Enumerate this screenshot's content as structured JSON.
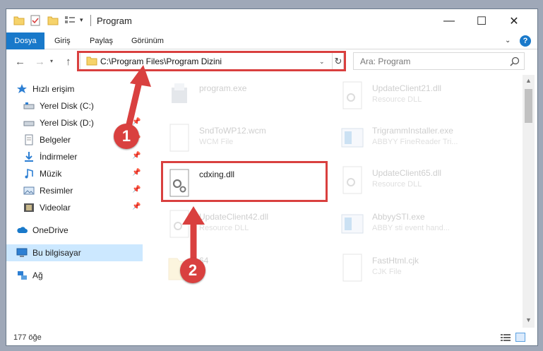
{
  "window": {
    "title": "Program",
    "controls": {
      "minimize": "—",
      "maximize": "☐",
      "close": "✕"
    }
  },
  "ribbon": {
    "tabs": [
      "Dosya",
      "Giriş",
      "Paylaş",
      "Görünüm"
    ],
    "help": "?"
  },
  "nav": {
    "address": "C:\\Program Files\\Program Dizini",
    "search_placeholder": "Ara: Program"
  },
  "sidebar": {
    "items": [
      {
        "label": "Hızlı erişim",
        "icon": "star-icon",
        "pinned": false
      },
      {
        "label": "Yerel Disk (C:)",
        "icon": "drive-icon",
        "pinned": true
      },
      {
        "label": "Yerel Disk (D:)",
        "icon": "drive-icon",
        "pinned": true
      },
      {
        "label": "Belgeler",
        "icon": "document-icon",
        "pinned": true
      },
      {
        "label": "İndirmeler",
        "icon": "download-icon",
        "pinned": true
      },
      {
        "label": "Müzik",
        "icon": "music-icon",
        "pinned": true
      },
      {
        "label": "Resimler",
        "icon": "pictures-icon",
        "pinned": true
      },
      {
        "label": "Videolar",
        "icon": "video-icon",
        "pinned": true
      },
      {
        "label": "OneDrive",
        "icon": "cloud-icon",
        "pinned": false
      },
      {
        "label": "Bu bilgisayar",
        "icon": "computer-icon",
        "pinned": false
      },
      {
        "label": "Ağ",
        "icon": "network-icon",
        "pinned": false
      }
    ]
  },
  "files": [
    {
      "name": "program.exe",
      "type": ""
    },
    {
      "name": "UpdateClient21.dll",
      "type": "Resource DLL"
    },
    {
      "name": "SndToWP12.wcm",
      "type": "WCM File"
    },
    {
      "name": "TrigrammInstaller.exe",
      "type": "ABBYY FineReader Tri..."
    },
    {
      "name": "cdxing.dll",
      "type": ""
    },
    {
      "name": "UpdateClient65.dll",
      "type": "Resource DLL"
    },
    {
      "name": "UpdateClient42.dll",
      "type": "Resource DLL"
    },
    {
      "name": "AbbyySTI.exe",
      "type": "ABBY sti event hand..."
    },
    {
      "name": "64",
      "type": ""
    },
    {
      "name": "FastHtml.cjk",
      "type": "CJK File"
    }
  ],
  "status": {
    "count": "177 öğe"
  },
  "annotations": {
    "step1": "1",
    "step2": "2"
  },
  "colors": {
    "accent": "#1979ca",
    "highlight": "#d9403f",
    "selected": "#cce8ff"
  }
}
